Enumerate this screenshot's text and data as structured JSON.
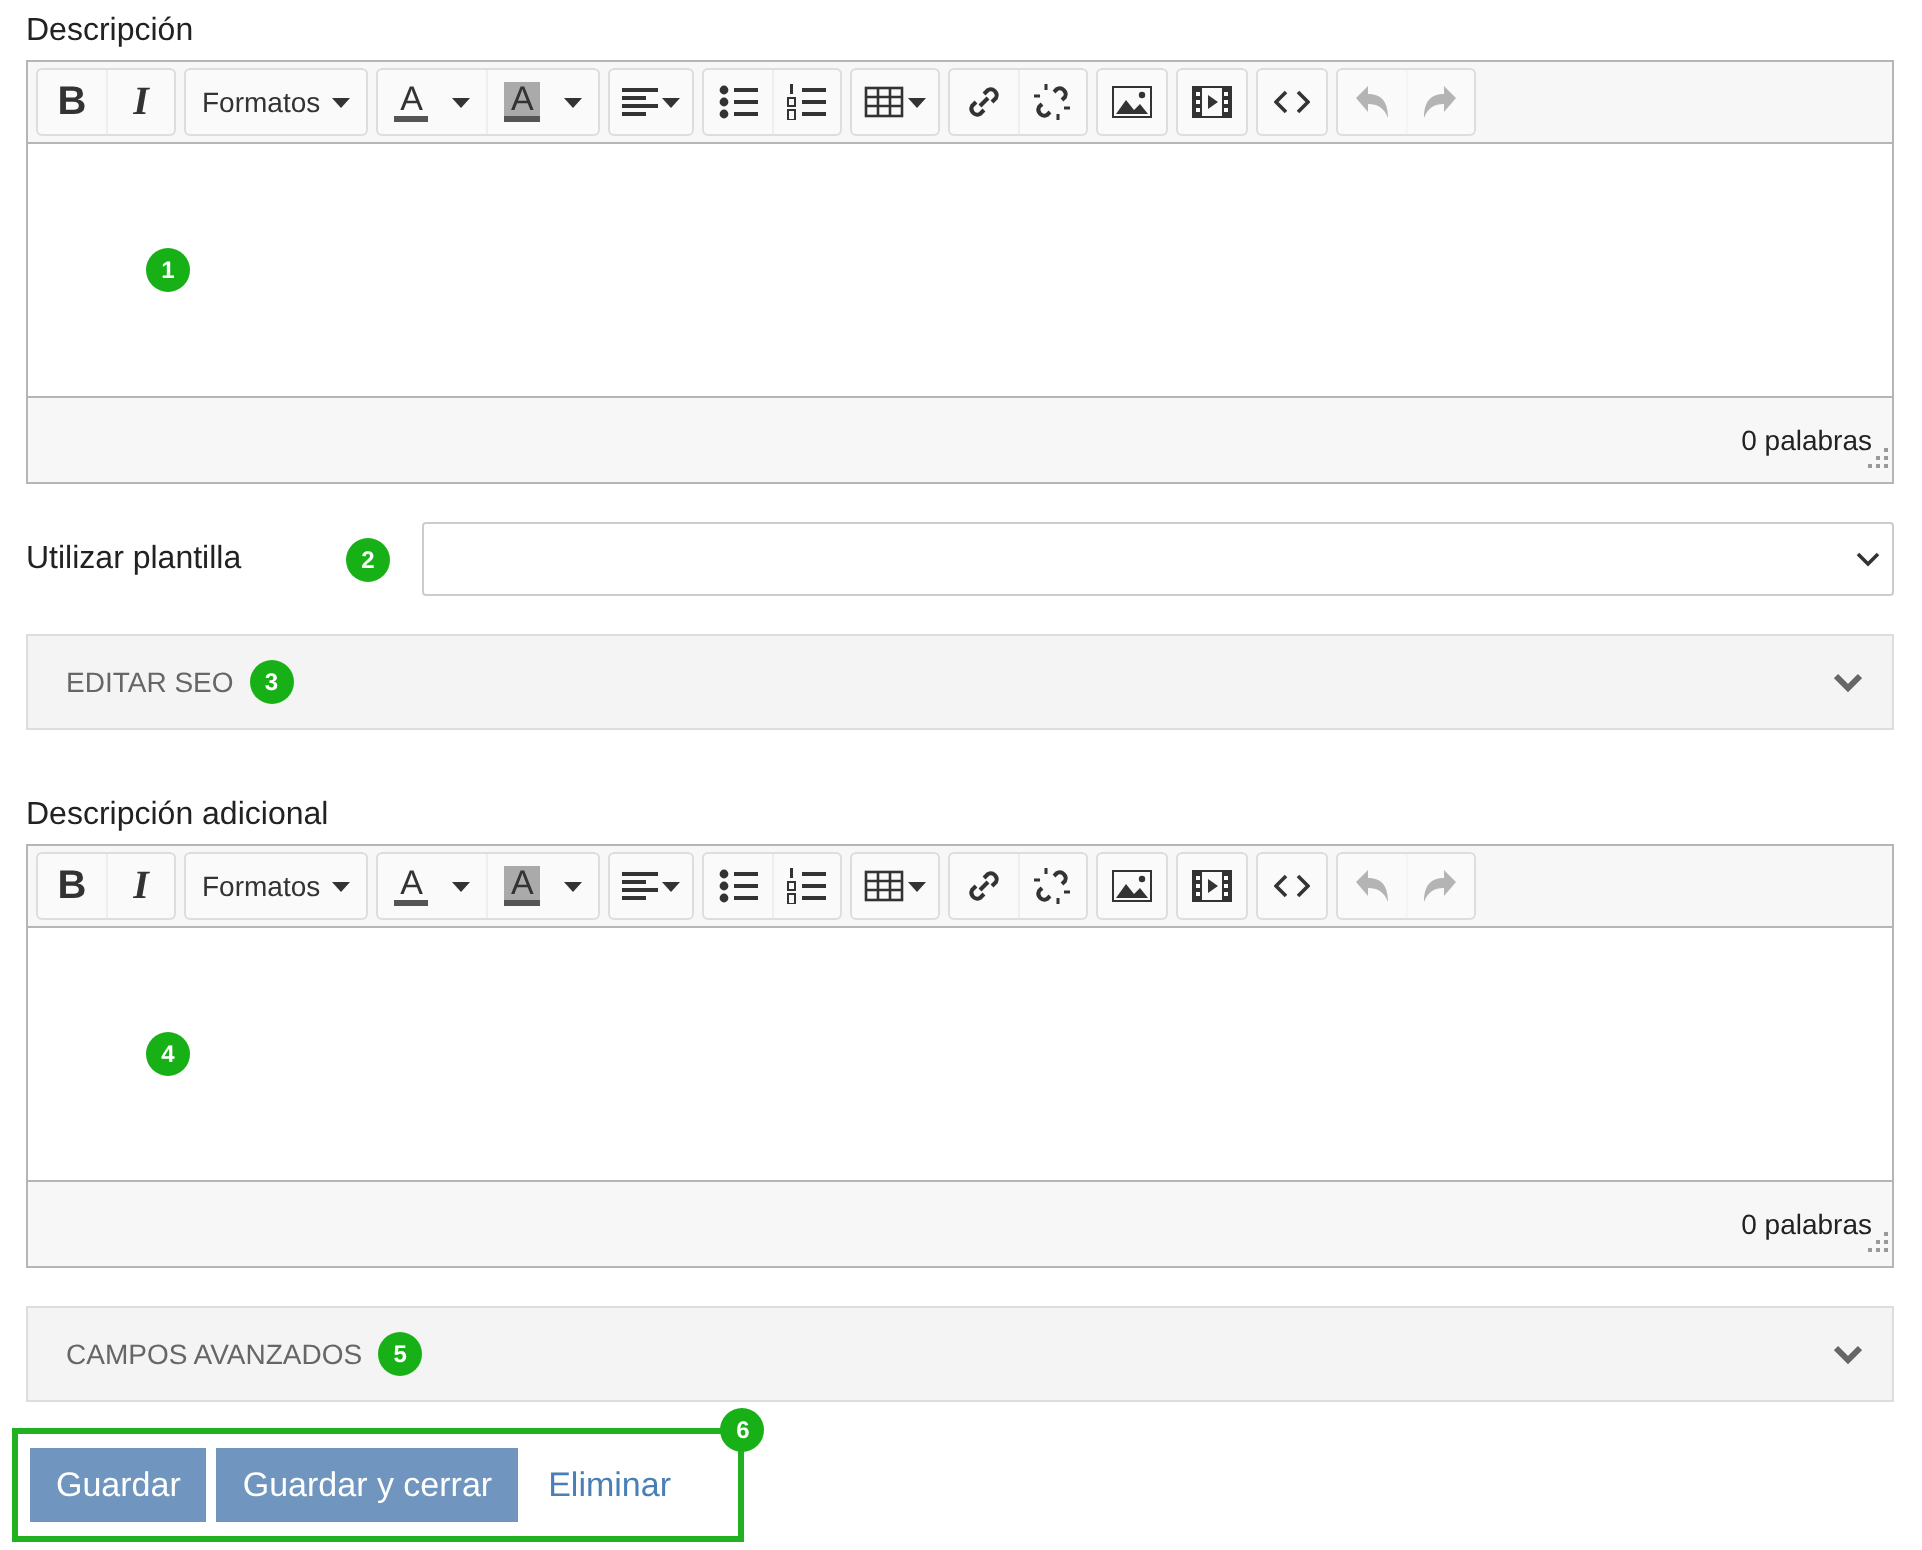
{
  "blocks": [
    {
      "kind": "editor",
      "label": "Descripción",
      "marker": "1",
      "word_count": "0 palabras",
      "toolbar": [
        [
          {
            "kind": "bold",
            "label": "B",
            "disabled": false
          },
          {
            "kind": "italic",
            "label": "I",
            "disabled": false
          }
        ],
        [
          {
            "kind": "menu",
            "label": "Formatos",
            "disabled": false
          }
        ],
        [
          {
            "kind": "textcolor",
            "label": "A",
            "disabled": false
          },
          {
            "kind": "bgcolor",
            "label": "A",
            "disabled": false
          }
        ],
        [
          {
            "kind": "align",
            "disabled": false
          }
        ],
        [
          {
            "kind": "bullist",
            "disabled": false
          },
          {
            "kind": "numlist",
            "disabled": false
          }
        ],
        [
          {
            "kind": "table",
            "disabled": false
          }
        ],
        [
          {
            "kind": "link",
            "disabled": false
          },
          {
            "kind": "unlink",
            "disabled": false
          }
        ],
        [
          {
            "kind": "image",
            "disabled": false
          }
        ],
        [
          {
            "kind": "media",
            "disabled": false
          }
        ],
        [
          {
            "kind": "code",
            "disabled": false
          }
        ],
        [
          {
            "kind": "undo",
            "disabled": true
          },
          {
            "kind": "redo",
            "disabled": true
          }
        ]
      ]
    },
    {
      "kind": "select",
      "label": "Utilizar plantilla",
      "marker": "2"
    },
    {
      "kind": "collapse",
      "title": "EDITAR SEO",
      "marker": "3",
      "expanded": false
    },
    {
      "kind": "editor",
      "label": "Descripción adicional",
      "marker": "4",
      "word_count": "0 palabras",
      "toolbar": [
        [
          {
            "kind": "bold",
            "label": "B",
            "disabled": false
          },
          {
            "kind": "italic",
            "label": "I",
            "disabled": false
          }
        ],
        [
          {
            "kind": "menu",
            "label": "Formatos",
            "disabled": false
          }
        ],
        [
          {
            "kind": "textcolor",
            "label": "A",
            "disabled": false
          },
          {
            "kind": "bgcolor",
            "label": "A",
            "disabled": false
          }
        ],
        [
          {
            "kind": "align",
            "disabled": false
          }
        ],
        [
          {
            "kind": "bullist",
            "disabled": false
          },
          {
            "kind": "numlist",
            "disabled": false
          }
        ],
        [
          {
            "kind": "table",
            "disabled": false
          }
        ],
        [
          {
            "kind": "link",
            "disabled": false
          },
          {
            "kind": "unlink",
            "disabled": false
          }
        ],
        [
          {
            "kind": "image",
            "disabled": false
          }
        ],
        [
          {
            "kind": "media",
            "disabled": false
          }
        ],
        [
          {
            "kind": "code",
            "disabled": false
          }
        ],
        [
          {
            "kind": "undo",
            "disabled": true
          },
          {
            "kind": "redo",
            "disabled": true
          }
        ]
      ]
    },
    {
      "kind": "collapse",
      "title": "CAMPOS AVANZADOS",
      "marker": "5",
      "expanded": false
    },
    {
      "kind": "actions",
      "marker": "6",
      "buttons": [
        {
          "kind": "primary",
          "label": "Guardar"
        },
        {
          "kind": "primary",
          "label": "Guardar y cerrar"
        },
        {
          "kind": "link",
          "label": "Eliminar"
        }
      ]
    }
  ]
}
